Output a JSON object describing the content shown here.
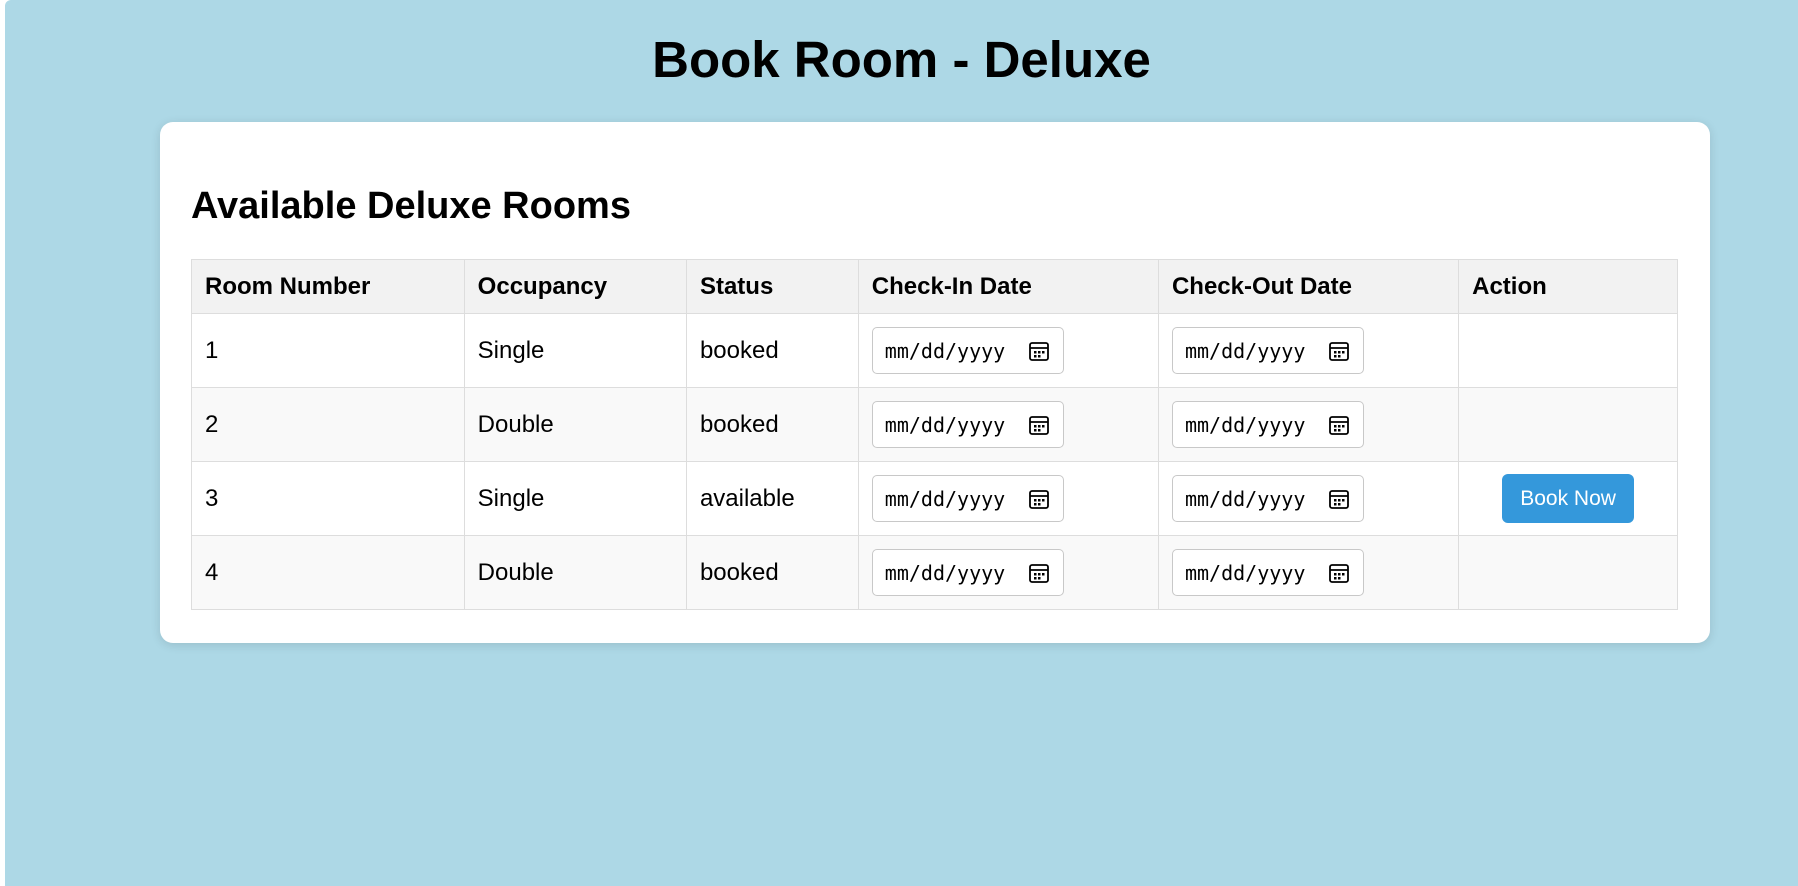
{
  "page": {
    "title": "Book Room - Deluxe",
    "background_color": "#add8e6"
  },
  "section": {
    "title": "Available Deluxe Rooms"
  },
  "table": {
    "columns": [
      "Room Number",
      "Occupancy",
      "Status",
      "Check-In Date",
      "Check-Out Date",
      "Action"
    ],
    "rows": [
      {
        "room_number": "1",
        "occupancy": "Single",
        "status": "booked",
        "check_in_placeholder": "mm/dd/yyyy",
        "check_out_placeholder": "mm/dd/yyyy",
        "action_label": ""
      },
      {
        "room_number": "2",
        "occupancy": "Double",
        "status": "booked",
        "check_in_placeholder": "mm/dd/yyyy",
        "check_out_placeholder": "mm/dd/yyyy",
        "action_label": ""
      },
      {
        "room_number": "3",
        "occupancy": "Single",
        "status": "available",
        "check_in_placeholder": "mm/dd/yyyy",
        "check_out_placeholder": "mm/dd/yyyy",
        "action_label": "Book Now"
      },
      {
        "room_number": "4",
        "occupancy": "Double",
        "status": "booked",
        "check_in_placeholder": "mm/dd/yyyy",
        "check_out_placeholder": "mm/dd/yyyy",
        "action_label": ""
      }
    ]
  },
  "icons": {
    "date_picker": "calendar-icon"
  },
  "colors": {
    "accent": "#3498db",
    "header_bg": "#f2f2f2",
    "stripe_bg": "#f9f9f9"
  }
}
